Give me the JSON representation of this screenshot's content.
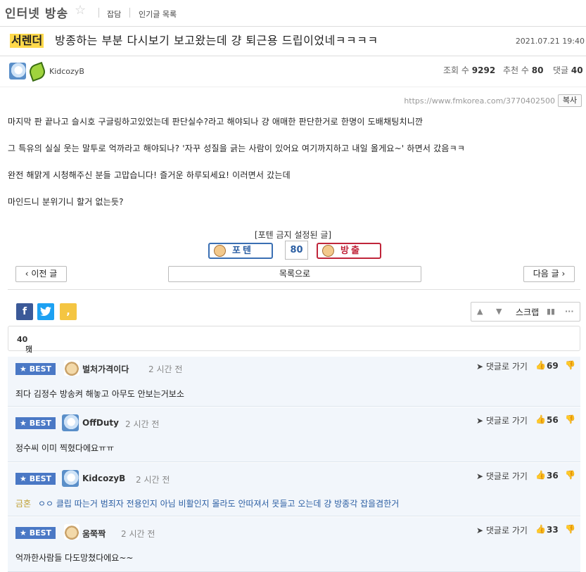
{
  "board": {
    "title": "인터넷 방송",
    "links": [
      "잡담",
      "인기글 목록"
    ]
  },
  "post": {
    "category": "서렌더",
    "title": "방종하는 부분 다시보기 보고왔는데 걍 퇴근용 드립이었네ㅋㅋㅋㅋ",
    "date": "2021.07.21 19:40",
    "author": "KidcozyB",
    "views_label": "조회 수",
    "views": "9292",
    "likes_label": "추천 수",
    "likes": "80",
    "comments_label": "댓글",
    "comments": "40",
    "url": "https://www.fmkorea.com/3770402500",
    "copy_label": "복사",
    "body": [
      "마지막 판 끝나고 슬시호 구글링하고있었는데 판단실수?라고 해야되나 걍 애매한 판단한거로 한명이 도배채팅치니깐",
      "그 특유의 실실 웃는 말투로 억까라고 해야되나? '자꾸 성질을 긁는 사람이 있어요 여기까지하고 내일 올게요~' 하면서 갔음ㅋㅋ",
      "완전 해맑게 시청해주신 분들 고맙습니다! 즐거운 하루되세요! 이러면서 갔는데",
      "마인드니 분위기니 할거 없는듯?"
    ]
  },
  "vote": {
    "note": "[포텐 금지 설정된 글]",
    "up_label": "포텐",
    "count": "80",
    "down_label": "방출"
  },
  "nav": {
    "prev": "이전 글",
    "list": "목록으로",
    "next": "다음 글"
  },
  "tools": {
    "scrap": "스크랩"
  },
  "comments_header": {
    "prefix": "댓글",
    "count": "40",
    "suffix": "개"
  },
  "comment_items": [
    {
      "badge": "BEST",
      "name": "벌처가격이다",
      "time": "2 시간 전",
      "goto": "댓글로 가기",
      "votes": "69",
      "text": "죄다 김정수 방송켜 해놓고 아무도 안보는거보소",
      "reply_to": ""
    },
    {
      "badge": "BEST",
      "name": "OffDuty",
      "time": "2 시간 전",
      "goto": "댓글로 가기",
      "votes": "56",
      "text": "정수씨 이미 찍혔다에요ㅠㅠ",
      "reply_to": ""
    },
    {
      "badge": "BEST",
      "name": "KidcozyB",
      "time": "2 시간 전",
      "goto": "댓글로 가기",
      "votes": "36",
      "text": "ㅇㅇ 클립 따는거 범죄자 전용인지 아님 비활인지 몰라도 안따져서 못들고 오는데 걍 방종각 잡을겸한거",
      "reply_to": "금혼"
    },
    {
      "badge": "BEST",
      "name": "움쭉짝",
      "time": "2 시간 전",
      "goto": "댓글로 가기",
      "votes": "33",
      "text": "억까한사람들 다도망쳤다에요~~",
      "reply_to": ""
    }
  ],
  "colors": {
    "best_badge": "#4a78c5",
    "category_highlight": "#ffd94a",
    "vote_up": "#3a6fb3",
    "vote_down": "#c0253a",
    "comment_bg": "#f2f6fb"
  }
}
